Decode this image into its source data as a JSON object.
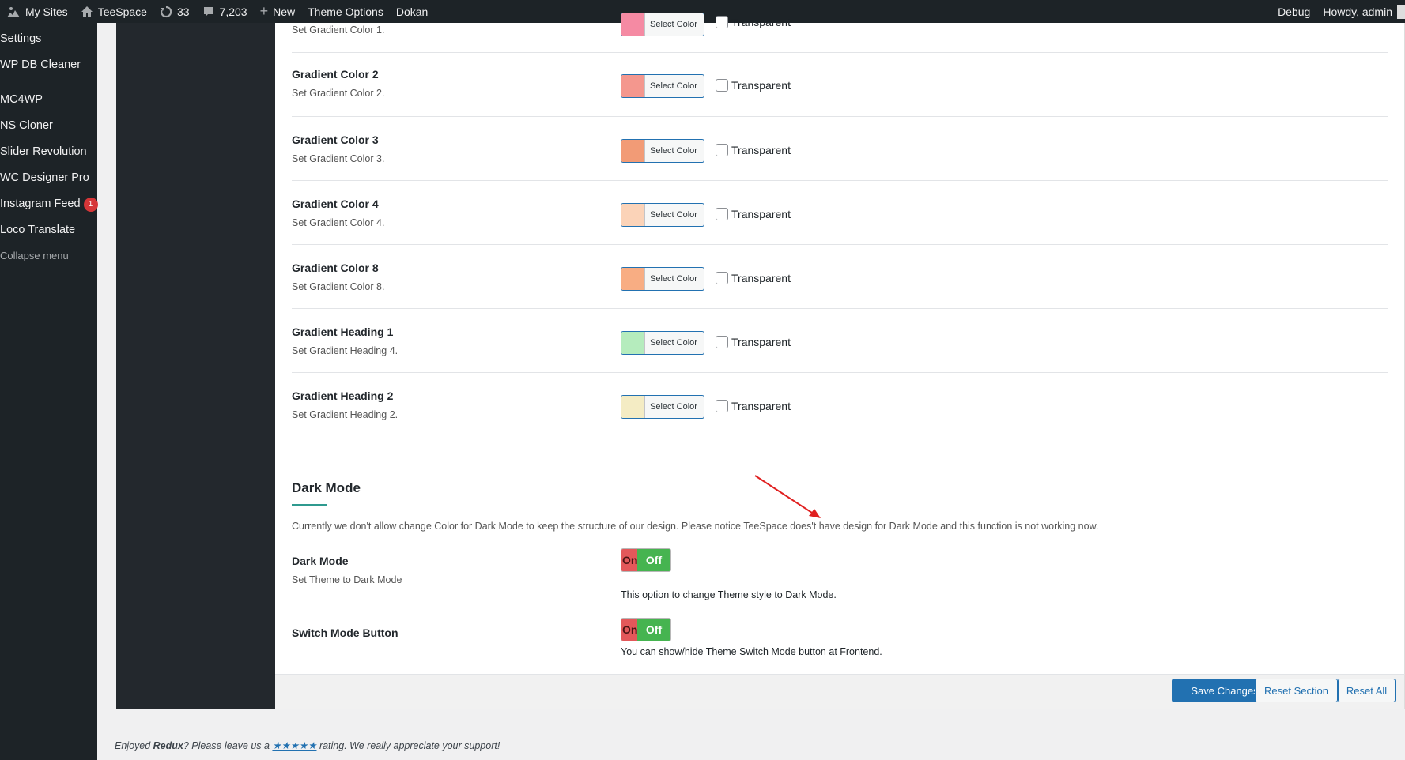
{
  "adminbar": {
    "my_sites": "My Sites",
    "site_name": "TeeSpace",
    "updates": "33",
    "comments": "7,203",
    "new": "New",
    "theme_options": "Theme Options",
    "dokan": "Dokan",
    "debug": "Debug",
    "howdy": "Howdy, admin"
  },
  "sidebar": {
    "items": [
      {
        "label": "Settings"
      },
      {
        "label": "WP DB Cleaner"
      },
      {
        "label": "MC4WP"
      },
      {
        "label": "NS Cloner"
      },
      {
        "label": "Slider Revolution"
      },
      {
        "label": "WC Designer Pro"
      },
      {
        "label": "Instagram Feed",
        "badge": "1"
      },
      {
        "label": "Loco Translate"
      }
    ],
    "collapse": "Collapse menu"
  },
  "fields": [
    {
      "title": "",
      "sub": "Set Gradient Color 1.",
      "color": "#f58aa3"
    },
    {
      "title": "Gradient Color 2",
      "sub": "Set Gradient Color 2.",
      "color": "#f4978e"
    },
    {
      "title": "Gradient Color 3",
      "sub": "Set Gradient Color 3.",
      "color": "#f29b76"
    },
    {
      "title": "Gradient Color 4",
      "sub": "Set Gradient Color 4.",
      "color": "#fbd3b8"
    },
    {
      "title": "Gradient Color 8",
      "sub": "Set Gradient Color 8.",
      "color": "#f8ad83"
    },
    {
      "title": "Gradient Heading 1",
      "sub": "Set Gradient Heading 4.",
      "color": "#b5ecbd"
    },
    {
      "title": "Gradient Heading 2",
      "sub": "Set Gradient Heading 2.",
      "color": "#f4ecc4"
    }
  ],
  "color_picker_label": "Select Color",
  "transparent_label": "Transparent",
  "dark_mode_section": {
    "title": "Dark Mode",
    "description": "Currently we don't allow change Color for Dark Mode to keep the structure of our design. Please notice TeeSpace does't have design for Dark Mode and this function is not working now."
  },
  "switches": [
    {
      "title": "Dark Mode",
      "sub": "Set Theme to Dark Mode",
      "on": "On",
      "off": "Off",
      "note": "This option to change Theme style to Dark Mode."
    },
    {
      "title": "Switch Mode Button",
      "sub": "",
      "on": "On",
      "off": "Off",
      "note": "You can show/hide Theme Switch Mode button at Frontend."
    }
  ],
  "buttons": {
    "save": "Save Changes",
    "reset_section": "Reset Section",
    "reset_all": "Reset All"
  },
  "credit": {
    "prefix": "Enjoyed ",
    "brand": "Redux",
    "middle": "? Please leave us a ",
    "stars": "★★★★★",
    "suffix": " rating. We really appreciate your support!"
  },
  "colors": {
    "primary": "#2271b1",
    "admin_dark": "#1d2327",
    "switch_on": "#e3585a",
    "switch_off": "#46b450",
    "annotation_arrow": "#e02020"
  }
}
